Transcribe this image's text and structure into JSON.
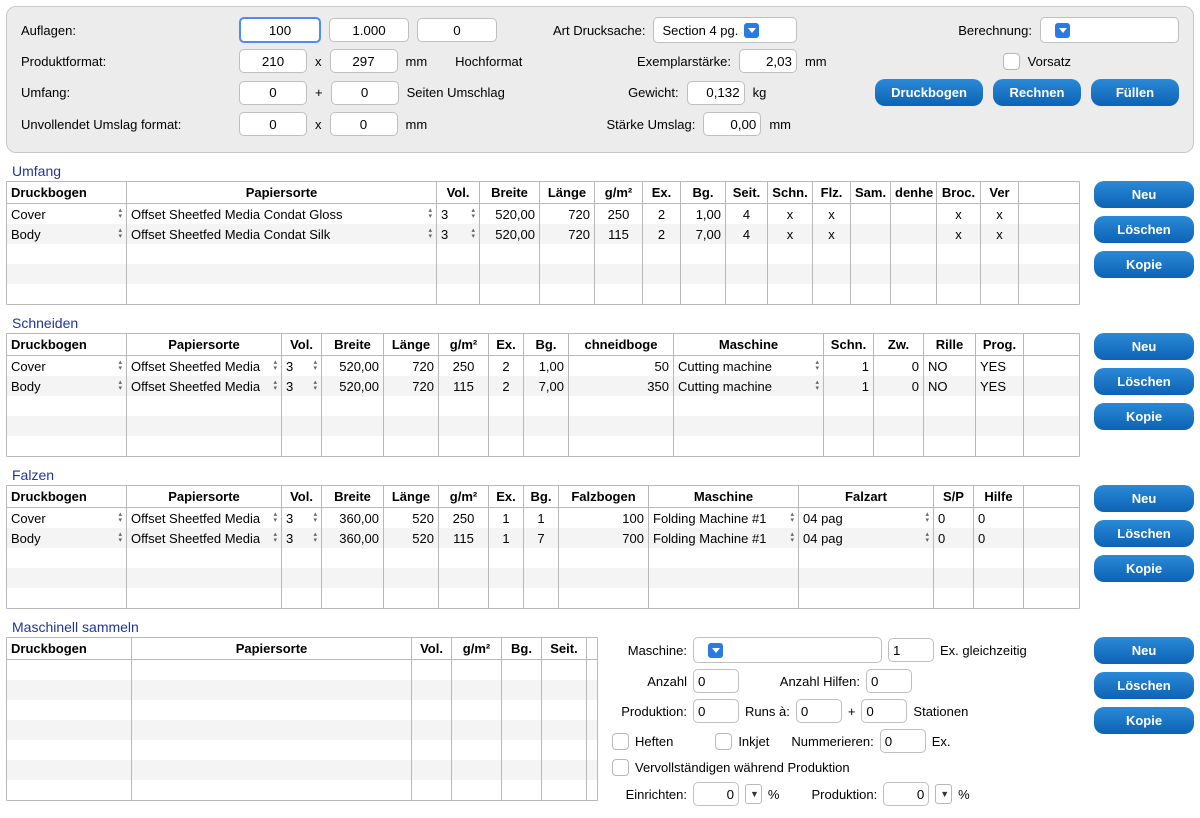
{
  "top": {
    "auflagen_label": "Auflagen:",
    "auflagen": [
      "100",
      "1.000",
      "0"
    ],
    "art_label": "Art Drucksache:",
    "art_value": "Section 4 pg.",
    "berechnung_label": "Berechnung:",
    "berechnung_value": "",
    "produktformat_label": "Produktformat:",
    "produkt_w": "210",
    "produkt_h": "297",
    "x": "x",
    "mm": "mm",
    "orientation": "Hochformat",
    "exemplarstaerke_label": "Exemplarstärke:",
    "exemplarstaerke": "2,03",
    "vorsatz": "Vorsatz",
    "umfang_label": "Umfang:",
    "umfang_a": "0",
    "plus": "+",
    "umfang_b": "0",
    "seiten_umslag": "Seiten Umschlag",
    "gewicht_label": "Gewicht:",
    "gewicht": "0,132",
    "kg": "kg",
    "unvoll_label": "Unvollendet Umslag format:",
    "unvoll_w": "0",
    "unvoll_h": "0",
    "staerke_label": "Stärke Umslag:",
    "staerke": "0,00",
    "btn_druckbogen": "Druckbogen",
    "btn_rechnen": "Rechnen",
    "btn_fullen": "Füllen"
  },
  "btns": {
    "neu": "Neu",
    "loeschen": "Löschen",
    "kopie": "Kopie"
  },
  "umfang": {
    "title": "Umfang",
    "headers": [
      "Druckbogen",
      "Papiersorte",
      "Vol.",
      "Breite",
      "Länge",
      "g/m²",
      "Ex.",
      "Bg.",
      "Seit.",
      "Schn.",
      "Flz.",
      "Sam.",
      "denhe",
      "Broc.",
      "Ver"
    ],
    "rows": [
      {
        "db": "Cover",
        "paper": "Offset Sheetfed Media Condat Gloss",
        "vol": "3",
        "breite": "520,00",
        "laenge": "720",
        "gm2": "250",
        "ex": "2",
        "bg": "1,00",
        "seit": "4",
        "schn": "x",
        "flz": "x",
        "sam": "",
        "denhe": "",
        "broc": "x",
        "ver": "x"
      },
      {
        "db": "Body",
        "paper": "Offset Sheetfed Media Condat Silk",
        "vol": "3",
        "breite": "520,00",
        "laenge": "720",
        "gm2": "115",
        "ex": "2",
        "bg": "7,00",
        "seit": "4",
        "schn": "x",
        "flz": "x",
        "sam": "",
        "denhe": "",
        "broc": "x",
        "ver": "x"
      }
    ]
  },
  "schneiden": {
    "title": "Schneiden",
    "headers": [
      "Druckbogen",
      "Papiersorte",
      "Vol.",
      "Breite",
      "Länge",
      "g/m²",
      "Ex.",
      "Bg.",
      "chneidboge",
      "Maschine",
      "Schn.",
      "Zw.",
      "Rille",
      "Prog."
    ],
    "rows": [
      {
        "db": "Cover",
        "paper": "Offset Sheetfed Media",
        "vol": "3",
        "breite": "520,00",
        "laenge": "720",
        "gm2": "250",
        "ex": "2",
        "bg": "1,00",
        "sb": "50",
        "maschine": "Cutting machine",
        "schn": "1",
        "zw": "0",
        "rille": "NO",
        "prog": "YES"
      },
      {
        "db": "Body",
        "paper": "Offset Sheetfed Media",
        "vol": "3",
        "breite": "520,00",
        "laenge": "720",
        "gm2": "115",
        "ex": "2",
        "bg": "7,00",
        "sb": "350",
        "maschine": "Cutting machine",
        "schn": "1",
        "zw": "0",
        "rille": "NO",
        "prog": "YES"
      }
    ]
  },
  "falzen": {
    "title": "Falzen",
    "headers": [
      "Druckbogen",
      "Papiersorte",
      "Vol.",
      "Breite",
      "Länge",
      "g/m²",
      "Ex.",
      "Bg.",
      "Falzbogen",
      "Maschine",
      "Falzart",
      "S/P",
      "Hilfe"
    ],
    "rows": [
      {
        "db": "Cover",
        "paper": "Offset Sheetfed Media",
        "vol": "3",
        "breite": "360,00",
        "laenge": "520",
        "gm2": "250",
        "ex": "1",
        "bg": "1",
        "fb": "100",
        "maschine": "Folding Machine #1",
        "falzart": "04 pag",
        "sp": "0",
        "hilfe": "0"
      },
      {
        "db": "Body",
        "paper": "Offset Sheetfed Media",
        "vol": "3",
        "breite": "360,00",
        "laenge": "520",
        "gm2": "115",
        "ex": "1",
        "bg": "7",
        "fb": "700",
        "maschine": "Folding Machine #1",
        "falzart": "04 pag",
        "sp": "0",
        "hilfe": "0"
      }
    ]
  },
  "sammeln": {
    "title": "Maschinell sammeln",
    "headers": [
      "Druckbogen",
      "Papiersorte",
      "Vol.",
      "g/m²",
      "Bg.",
      "Seit."
    ]
  },
  "bottom": {
    "maschine_label": "Maschine:",
    "maschine_value": "",
    "ex_gleich": "Ex. gleichzeitig",
    "ex_gleich_val": "1",
    "anzahl_label": "Anzahl",
    "anzahl": "0",
    "hilfen_label": "Anzahl Hilfen:",
    "hilfen": "0",
    "produktion_label": "Produktion:",
    "produktion": "0",
    "runs_label": "Runs à:",
    "runs": "0",
    "plus": "+",
    "runs2": "0",
    "stationen": "Stationen",
    "heften": "Heften",
    "inkjet": "Inkjet",
    "nummerieren_label": "Nummerieren:",
    "nummerieren": "0",
    "ex": "Ex.",
    "vervoll": "Vervollständigen während Produktion",
    "einrichten_label": "Einrichten:",
    "einrichten": "0",
    "pct": "%",
    "produktion2_label": "Produktion:",
    "produktion2": "0"
  }
}
